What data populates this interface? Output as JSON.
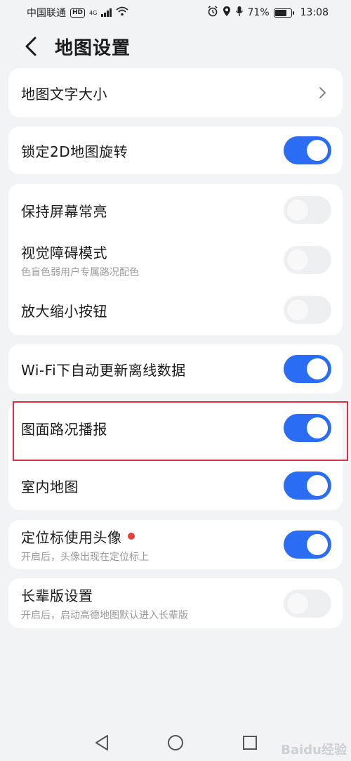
{
  "status_bar": {
    "carrier": "中国联通",
    "hd": "HD",
    "net": "4G",
    "battery": "71%",
    "time": "13:08"
  },
  "header": {
    "title": "地图设置"
  },
  "settings": {
    "map_text_size": {
      "label": "地图文字大小"
    },
    "lock_2d_rotation": {
      "label": "锁定2D地图旋转",
      "on": true
    },
    "keep_screen_on": {
      "label": "保持屏幕常亮",
      "on": false
    },
    "vision_mode": {
      "label": "视觉障碍模式",
      "sub": "色盲色弱用户专属路况配色",
      "on": false
    },
    "zoom_buttons": {
      "label": "放大缩小按钮",
      "on": false
    },
    "wifi_offline_update": {
      "label": "Wi-Fi下自动更新离线数据",
      "on": true
    },
    "traffic_broadcast": {
      "label": "图面路况播报",
      "on": true
    },
    "indoor_map": {
      "label": "室内地图",
      "on": true
    },
    "avatar_marker": {
      "label": "定位标使用头像",
      "sub": "开启后，头像出现在定位标上",
      "on": true
    },
    "elder_mode": {
      "label": "长辈版设置",
      "sub": "开启后，启动高德地图默认进入长辈版",
      "on": false
    }
  },
  "colors": {
    "toggle_on": "#2a6df4",
    "toggle_off": "#eeeff1",
    "highlight": "#d9333f",
    "red_dot": "#e8403a"
  },
  "watermark": "Baidu经验"
}
